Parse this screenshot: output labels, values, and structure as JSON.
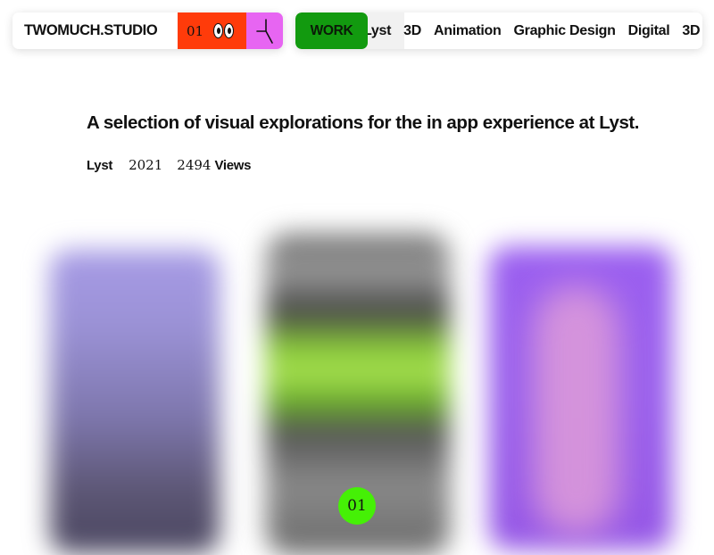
{
  "nav": {
    "brand": "TWOMUCH.STUDIO",
    "counter": "01",
    "work_label": "WORK",
    "categories": [
      "Lyst",
      "3D",
      "Animation",
      "Graphic Design",
      "Digital",
      "3D"
    ]
  },
  "project": {
    "headline": "A selection of visual explorations for the in app experience at Lyst.",
    "client": "Lyst",
    "year": "2021",
    "views_count": "2494",
    "views_label": "Views"
  },
  "gallery": {
    "pager_label": "01"
  },
  "icons": {
    "eyes": "eyes-icon",
    "cursor": "cursor-icon"
  },
  "colors": {
    "counter_bg": "#ff3b0a",
    "cursor_bg": "#e765f2",
    "work_bg": "#129a0f",
    "pager_bg": "#45f006"
  }
}
